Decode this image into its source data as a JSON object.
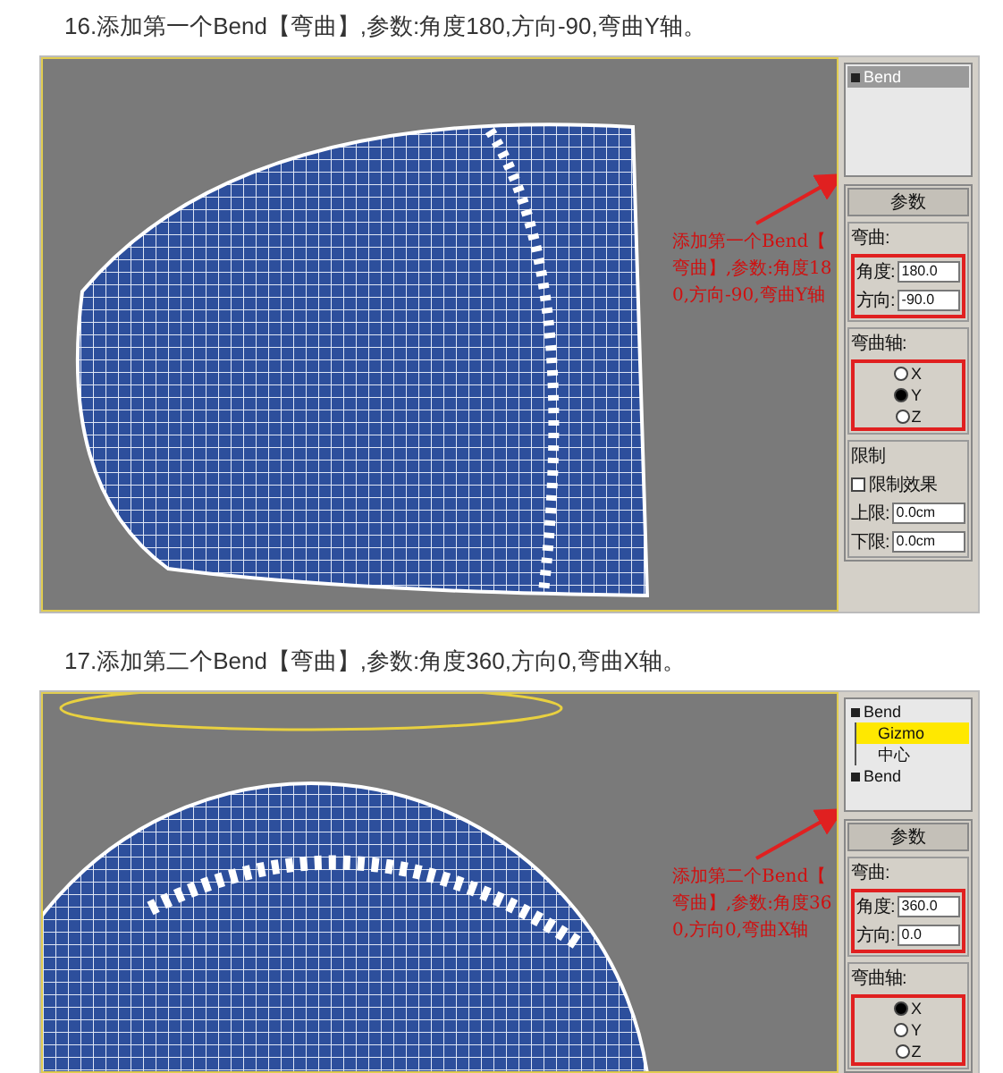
{
  "steps": [
    {
      "caption": "16.添加第一个Bend【弯曲】,参数:角度180,方向-90,弯曲Y轴。",
      "kind": "sheet",
      "annotation": "添加第一个Bend【弯曲】,参数:角度180,方向-90,弯曲Y轴",
      "stack": [
        {
          "label": "Bend",
          "kind": "modifier",
          "selected": true
        }
      ],
      "params": {
        "title": "参数",
        "bend_label": "弯曲:",
        "angle_label": "角度:",
        "angle": "180.0",
        "direction_label": "方向:",
        "direction": "-90.0",
        "axis_label": "弯曲轴:",
        "axes": [
          {
            "label": "X",
            "selected": false
          },
          {
            "label": "Y",
            "selected": true
          },
          {
            "label": "Z",
            "selected": false
          }
        ],
        "limits_label": "限制",
        "limit_effect": "限制效果",
        "limit_on": false,
        "upper_label": "上限:",
        "upper": "0.0cm",
        "lower_label": "下限:",
        "lower": "0.0cm"
      }
    },
    {
      "caption": "17.添加第二个Bend【弯曲】,参数:角度360,方向0,弯曲X轴。",
      "kind": "sphere",
      "annotation": "添加第二个Bend【弯曲】,参数:角度360,方向0,弯曲X轴",
      "stack": [
        {
          "label": "Bend",
          "kind": "modifier",
          "selected": false,
          "children": [
            {
              "label": "Gizmo",
              "kind": "subobject",
              "selected": true
            },
            {
              "label": "中心",
              "kind": "subobject",
              "selected": false
            }
          ]
        },
        {
          "label": "Bend",
          "kind": "modifier",
          "selected": false
        }
      ],
      "params": {
        "title": "参数",
        "bend_label": "弯曲:",
        "angle_label": "角度:",
        "angle": "360.0",
        "direction_label": "方向:",
        "direction": "0.0",
        "axis_label": "弯曲轴:",
        "axes": [
          {
            "label": "X",
            "selected": true
          },
          {
            "label": "Y",
            "selected": false
          },
          {
            "label": "Z",
            "selected": false
          }
        ]
      }
    }
  ]
}
